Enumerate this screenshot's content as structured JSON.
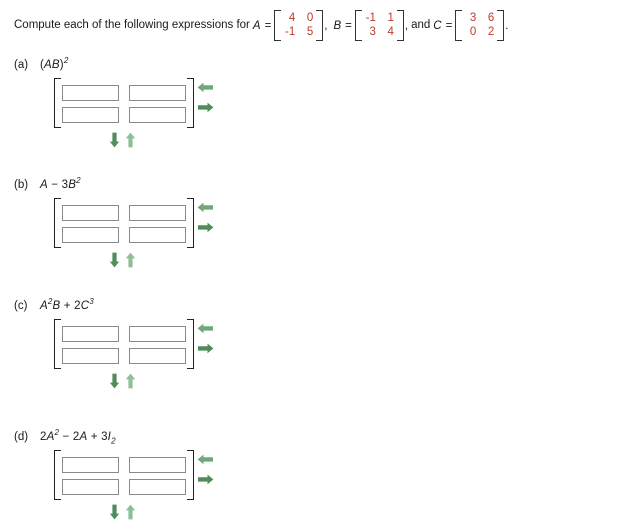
{
  "prompt": {
    "lead": "Compute each of the following expressions for",
    "var_a": "A",
    "eq": "=",
    "comma_after_a": ",",
    "var_b": "B",
    "comma_after_b": ",",
    "and_text": "and",
    "var_c": "C",
    "period": "."
  },
  "matrices": {
    "A": {
      "name": "A",
      "rows": [
        [
          "4",
          "0"
        ],
        [
          "-1",
          "5"
        ]
      ],
      "color": "#c0392b"
    },
    "B": {
      "name": "B",
      "rows": [
        [
          "-1",
          "1"
        ],
        [
          "3",
          "4"
        ]
      ],
      "color": "#c0392b"
    },
    "C": {
      "name": "C",
      "rows": [
        [
          "3",
          "6"
        ],
        [
          "0",
          "2"
        ]
      ],
      "color": "#c0392b"
    }
  },
  "questions": [
    {
      "tag": "(a)",
      "expression": "(AB)^2",
      "expr_parts": [
        {
          "t": "(",
          "style": "normal"
        },
        {
          "t": "AB",
          "style": "italic"
        },
        {
          "t": ")",
          "style": "normal"
        },
        {
          "t": "2",
          "style": "sup"
        }
      ],
      "answer_grid": [
        [
          "",
          ""
        ],
        [
          "",
          ""
        ]
      ],
      "answer_placeholder": ""
    },
    {
      "tag": "(b)",
      "expression": "A - 3B^2",
      "expr_parts": [
        {
          "t": "A",
          "style": "italic"
        },
        {
          "t": " − ",
          "style": "normal"
        },
        {
          "t": "3",
          "style": "normal"
        },
        {
          "t": "B",
          "style": "italic"
        },
        {
          "t": "2",
          "style": "sup"
        }
      ],
      "answer_grid": [
        [
          "",
          ""
        ],
        [
          "",
          ""
        ]
      ],
      "answer_placeholder": ""
    },
    {
      "tag": "(c)",
      "expression": "A^2 B + 2C^3",
      "expr_parts": [
        {
          "t": "A",
          "style": "italic"
        },
        {
          "t": "2",
          "style": "sup"
        },
        {
          "t": "B",
          "style": "italic"
        },
        {
          "t": " + ",
          "style": "normal"
        },
        {
          "t": "2",
          "style": "normal"
        },
        {
          "t": "C",
          "style": "italic"
        },
        {
          "t": "3",
          "style": "sup"
        }
      ],
      "answer_grid": [
        [
          "",
          ""
        ],
        [
          "",
          ""
        ]
      ],
      "answer_placeholder": ""
    },
    {
      "tag": "(d)",
      "expression": "2A^2 - 2A + 3I_2",
      "expr_parts": [
        {
          "t": "2",
          "style": "normal"
        },
        {
          "t": "A",
          "style": "italic"
        },
        {
          "t": "2",
          "style": "sup"
        },
        {
          "t": " − ",
          "style": "normal"
        },
        {
          "t": "2",
          "style": "normal"
        },
        {
          "t": "A",
          "style": "italic"
        },
        {
          "t": " + ",
          "style": "normal"
        },
        {
          "t": "3",
          "style": "normal"
        },
        {
          "t": "I",
          "style": "italic"
        },
        {
          "t": "2",
          "style": "sub"
        }
      ],
      "answer_grid": [
        [
          "",
          ""
        ],
        [
          "",
          ""
        ]
      ],
      "answer_placeholder": ""
    }
  ],
  "controls": {
    "row_remove_label": "remove-row-arrow-left",
    "row_add_label": "add-row-arrow-right",
    "col_remove_label": "remove-column-arrow-down",
    "col_add_label": "add-column-arrow-up",
    "arrow_color_dark": "#4f8c5a",
    "arrow_color_light": "#8fbf96",
    "arrow_color_mid": "#6fa878"
  }
}
